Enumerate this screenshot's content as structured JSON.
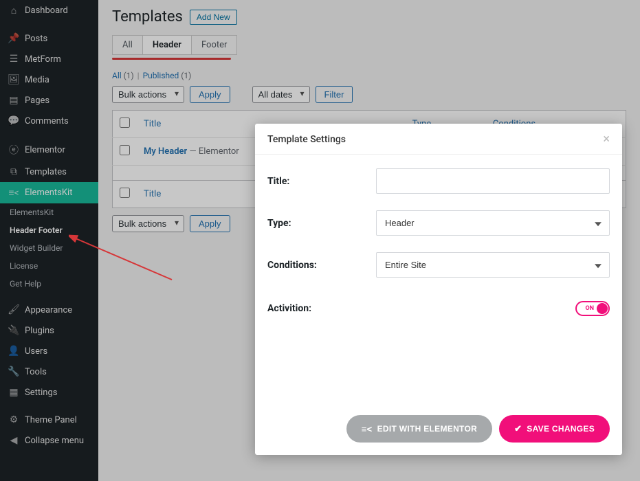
{
  "sidebar": {
    "items": [
      {
        "label": "Dashboard",
        "icon": "dashboard"
      },
      {
        "label": "Posts",
        "icon": "pin"
      },
      {
        "label": "MetForm",
        "icon": "metform"
      },
      {
        "label": "Media",
        "icon": "media"
      },
      {
        "label": "Pages",
        "icon": "pages"
      },
      {
        "label": "Comments",
        "icon": "comment"
      },
      {
        "label": "Elementor",
        "icon": "elementor"
      },
      {
        "label": "Templates",
        "icon": "templates"
      },
      {
        "label": "ElementsKit",
        "icon": "elementskit"
      },
      {
        "label": "Appearance",
        "icon": "brush"
      },
      {
        "label": "Plugins",
        "icon": "plugin"
      },
      {
        "label": "Users",
        "icon": "user"
      },
      {
        "label": "Tools",
        "icon": "tool"
      },
      {
        "label": "Settings",
        "icon": "settings"
      },
      {
        "label": "Theme Panel",
        "icon": "gear"
      },
      {
        "label": "Collapse menu",
        "icon": "collapse"
      }
    ],
    "sub": [
      {
        "label": "ElementsKit"
      },
      {
        "label": "Header Footer"
      },
      {
        "label": "Widget Builder"
      },
      {
        "label": "License"
      },
      {
        "label": "Get Help"
      }
    ]
  },
  "page": {
    "title": "Templates",
    "add_new": "Add New",
    "tabs": {
      "all": "All",
      "header": "Header",
      "footer": "Footer"
    },
    "subsub": {
      "all": "All",
      "all_count": "(1)",
      "published": "Published",
      "published_count": "(1)"
    },
    "bulk_label": "Bulk actions",
    "apply": "Apply",
    "dates": "All dates",
    "filter": "Filter",
    "columns": {
      "title": "Title",
      "type": "Type",
      "conditions": "Conditions"
    },
    "row": {
      "title": "My Header",
      "suffix": " — Elementor"
    }
  },
  "modal": {
    "title": "Template Settings",
    "labels": {
      "title": "Title:",
      "type": "Type:",
      "conditions": "Conditions:",
      "activation": "Activition:"
    },
    "values": {
      "title": "",
      "type": "Header",
      "conditions": "Entire Site",
      "toggle": "ON"
    },
    "buttons": {
      "edit": "EDIT WITH ELEMENTOR",
      "save": "SAVE CHANGES"
    }
  }
}
